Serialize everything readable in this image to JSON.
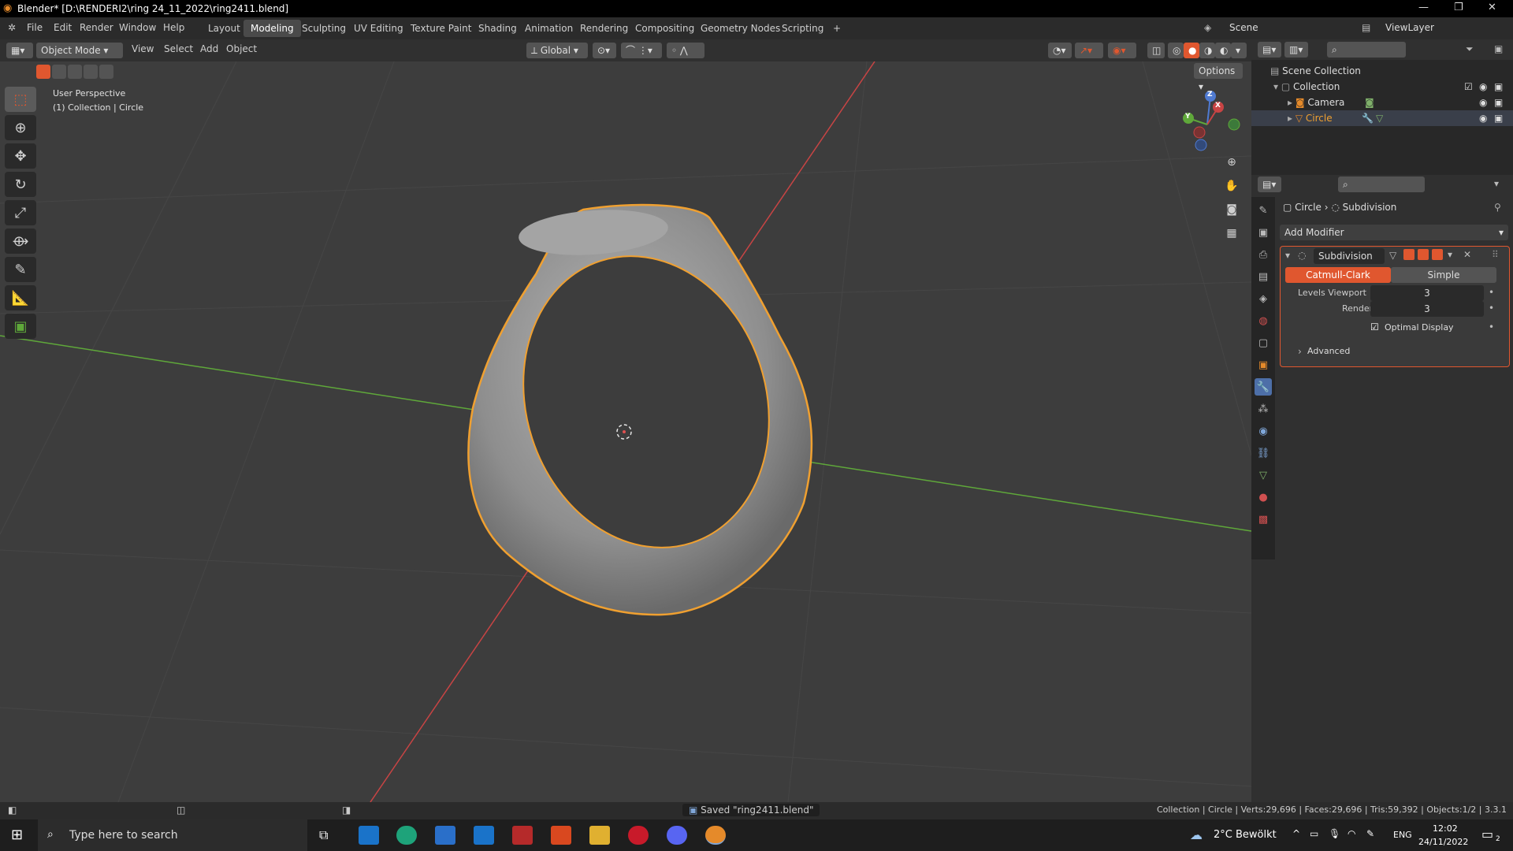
{
  "window": {
    "title": "Blender* [D:\\RENDERI2\\ring 24_11_2022\\ring2411.blend]",
    "controls": [
      "—",
      "❐",
      "✕"
    ]
  },
  "menu": [
    "File",
    "Edit",
    "Render",
    "Window",
    "Help"
  ],
  "workspaces": [
    "Layout",
    "Modeling",
    "Sculpting",
    "UV Editing",
    "Texture Paint",
    "Shading",
    "Animation",
    "Rendering",
    "Compositing",
    "Geometry Nodes",
    "Scripting",
    "+"
  ],
  "scene": {
    "label": "Scene",
    "viewlayer": "ViewLayer"
  },
  "header3d": {
    "mode": "Object Mode",
    "menus": [
      "View",
      "Select",
      "Add",
      "Object"
    ],
    "orientation": "Global",
    "options": "Options"
  },
  "viewport": {
    "perspective": "User Perspective",
    "collection_info": "(1) Collection | Circle"
  },
  "gizmo": {
    "x": "X",
    "y": "Y",
    "z": "Z"
  },
  "outliner": {
    "scene_collection": "Scene Collection",
    "collection": "Collection",
    "camera": "Camera",
    "circle": "Circle"
  },
  "properties": {
    "breadcrumb_obj": "Circle",
    "breadcrumb_mod": "Subdivision",
    "add_modifier": "Add Modifier",
    "modifier_name": "Subdivision",
    "catmull": "Catmull-Clark",
    "simple": "Simple",
    "levels_label": "Levels Viewport",
    "levels_value": "3",
    "render_label": "Render",
    "render_value": "3",
    "optimal": "Optimal Display",
    "advanced": "Advanced"
  },
  "status": {
    "saved": "Saved \"ring2411.blend\"",
    "stats": "Collection | Circle | Verts:29,696 | Faces:29,696 | Tris:59,392 | Objects:1/2 | 3.3.1"
  },
  "taskbar": {
    "search": "Type here to search",
    "weather": "2°C  Bewölkt",
    "lang": "ENG",
    "time": "12:02",
    "date": "24/11/2022",
    "notif": "2"
  },
  "colors": {
    "accent": "#e58a2a",
    "selected_outline": "#f0a030",
    "active_button": "#e0572f",
    "x_axis": "#c84444",
    "y_axis": "#5fa83a"
  }
}
